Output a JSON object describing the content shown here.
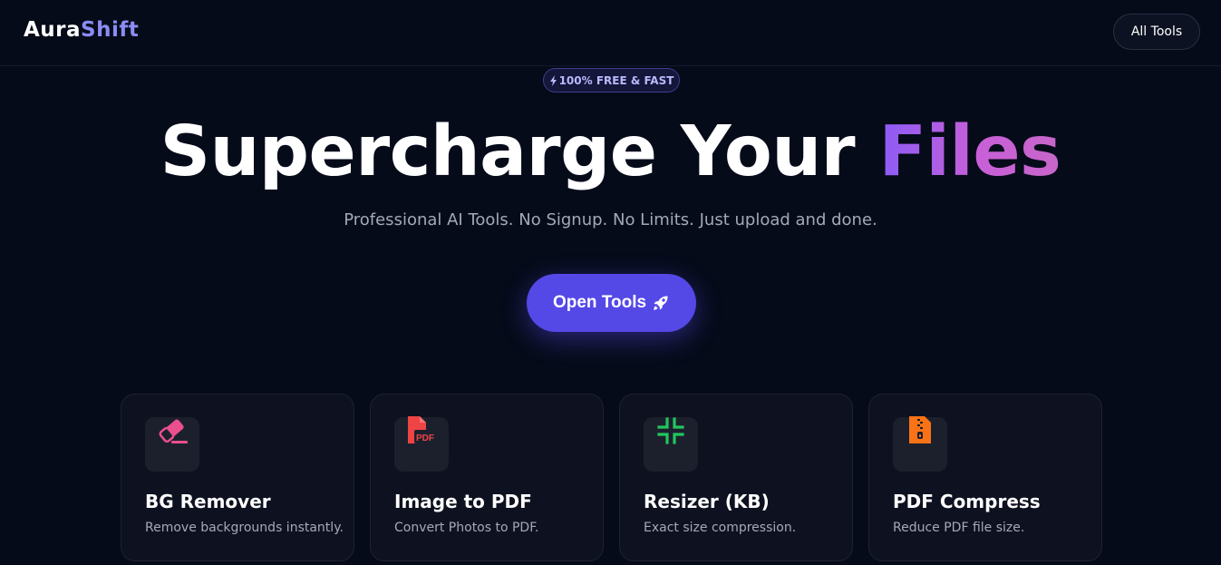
{
  "header": {
    "logo_part1": "Aura",
    "logo_part2": "Shift",
    "nav_button": "All Tools"
  },
  "hero": {
    "badge_icon": "lightning-icon",
    "badge_text": "100% FREE & FAST",
    "headline_part1": "Supercharge Your",
    "headline_part2": "Files",
    "subtitle": "Professional AI Tools. No Signup. No Limits. Just upload and done.",
    "cta_label": "Open Tools",
    "cta_icon": "rocket-icon"
  },
  "tools": [
    {
      "title": "BG Remover",
      "desc": "Remove backgrounds instantly.",
      "icon": "eraser-icon",
      "color": "#ec4f8d"
    },
    {
      "title": "Image to PDF",
      "desc": "Convert Photos to PDF.",
      "icon": "pdf-file-icon",
      "color": "#ef4444"
    },
    {
      "title": "Resizer (KB)",
      "desc": "Exact size compression.",
      "icon": "compress-icon",
      "color": "#22c55e"
    },
    {
      "title": "PDF Compress",
      "desc": "Reduce PDF file size.",
      "icon": "zip-file-icon",
      "color": "#f97316"
    }
  ],
  "colors": {
    "background": "#060b1a",
    "accent": "#5448e6",
    "logo_accent": "#8b8cf5",
    "gradient_start": "#8a5cf6",
    "gradient_end": "#c766c9"
  }
}
